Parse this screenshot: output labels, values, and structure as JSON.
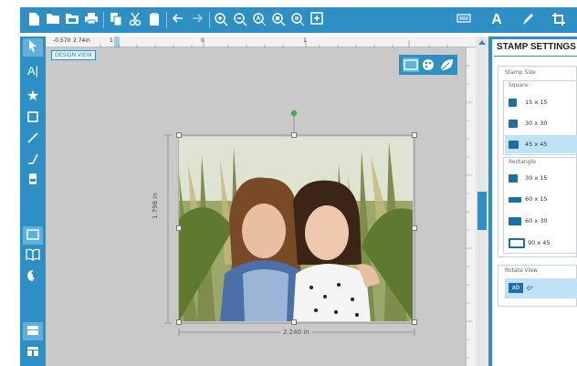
{
  "canvas": {
    "design_view_label": "DESIGN VIEW",
    "ruler_marks": [
      "-0.570",
      "2.74in",
      "1",
      "0",
      "1"
    ],
    "width_dimension": "2.240 in",
    "height_dimension": "1.798 in"
  },
  "panel": {
    "title": "STAMP SETTINGS",
    "stamp_size_label": "Stamp Size",
    "square_label": "Square",
    "square_sizes": [
      "15 x 15",
      "30 x 30",
      "45 x 45"
    ],
    "rectangle_label": "Rectangle",
    "rectangle_sizes": [
      "30 x 15",
      "60 x 15",
      "60 x 30",
      "90 x 45"
    ],
    "rotate_label": "Rotate View",
    "rotate_button": "ab",
    "rotate_value": "0°"
  },
  "toolbar": {
    "right_text_tool": "A"
  },
  "colors": {
    "accent": "#2d8fc3",
    "selected": "#bfe2f4",
    "canvas_bg": "#c9c9c9"
  }
}
